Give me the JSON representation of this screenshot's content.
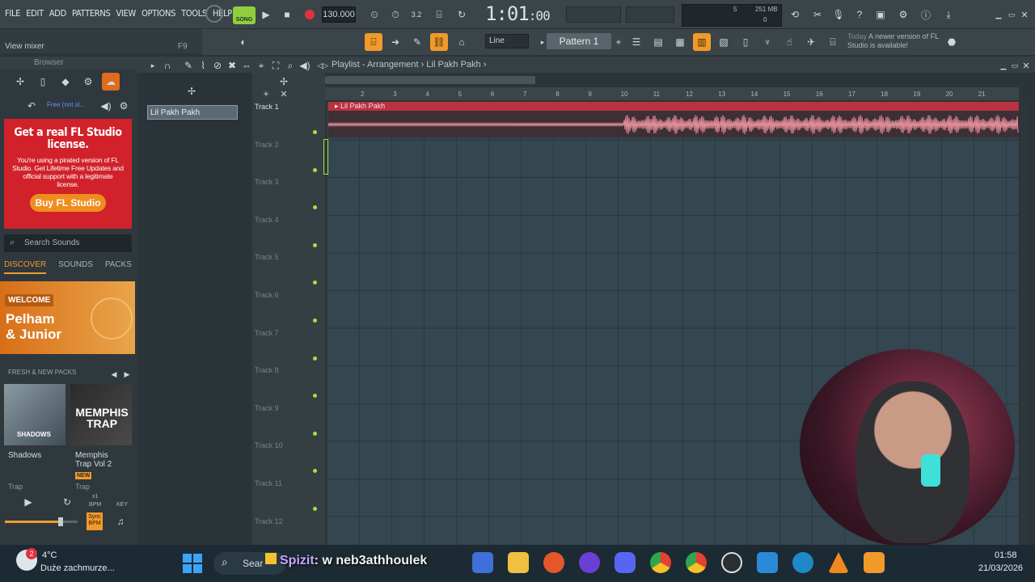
{
  "menubar": {
    "items": [
      "FILE",
      "EDIT",
      "ADD",
      "PATTERNS",
      "VIEW",
      "OPTIONS",
      "TOOLS",
      "HELP"
    ]
  },
  "transport": {
    "mode_label": "SONG",
    "tempo": "130.000",
    "time_main": "1:01",
    "time_sub": ":00",
    "memory_top": "5",
    "memory_mb": "251 MB",
    "memory_bottom": "0"
  },
  "hint": {
    "label": "View mixer",
    "shortcut": "F9"
  },
  "toolbar2": {
    "snap": "Line",
    "pattern": "Pattern 1",
    "notif_prefix": "Today",
    "notif_text": "A newer version of FL Studio is available!"
  },
  "browser": {
    "title": "Browser",
    "free_label": "Free (not sl...",
    "ad": {
      "title": "Get a real FL Studio license.",
      "body": "You're using a pirated version of FL Studio. Get Lifetime Free Updates and official support with a legitimate license.",
      "button": "Buy FL Studio"
    },
    "search_placeholder": "Search Sounds",
    "tabs": [
      "DISCOVER",
      "SOUNDS",
      "PACKS"
    ],
    "welcome": {
      "tag": "WELCOME",
      "title_line1": "Pelham",
      "title_line2": "& Junior"
    },
    "fresh_label": "FRESH & NEW PACKS",
    "packs": [
      {
        "name": "Shadows",
        "genre": "Trap",
        "cover_text": "SHADOWS"
      },
      {
        "name": "Memphis Trap Vol 2",
        "genre": "Trap",
        "badge": "NEW",
        "cover_text": "MEMPHIS TRAP"
      }
    ],
    "player": {
      "speed": "x1",
      "bpm_label": "BPM",
      "key_label": "KEY",
      "sync_label": "Sync BPM"
    }
  },
  "playlist": {
    "breadcrumb": [
      "Playlist - Arrangement",
      "Lil Pakh Pakh"
    ],
    "pattern_item": "Lil Pakh Pakh",
    "clip_name": "Lil Pakh Pakh",
    "tracks": [
      "Track 1",
      "Track 2",
      "Track 3",
      "Track 4",
      "Track 5",
      "Track 6",
      "Track 7",
      "Track 8",
      "Track 9",
      "Track 10",
      "Track 11",
      "Track 12"
    ],
    "ruler": [
      "2",
      "3",
      "4",
      "5",
      "6",
      "7",
      "8",
      "9",
      "10",
      "11",
      "12",
      "13",
      "14",
      "15",
      "16",
      "17",
      "18",
      "19",
      "20",
      "21"
    ]
  },
  "taskbar": {
    "temp": "4°C",
    "weather": "Duże zachmurze...",
    "search": "Sear",
    "overlay_prefix": "Spizit",
    "overlay_text": ": w neb3athhoulek",
    "time": "01:58",
    "date": "21/03/2026",
    "notif_count": "2"
  },
  "colors": {
    "accent": "#f19a2a",
    "song_green": "#8fcf3c",
    "ad_red": "#d1222b",
    "clip_red": "#b83240",
    "led_green": "#9ee53e"
  }
}
